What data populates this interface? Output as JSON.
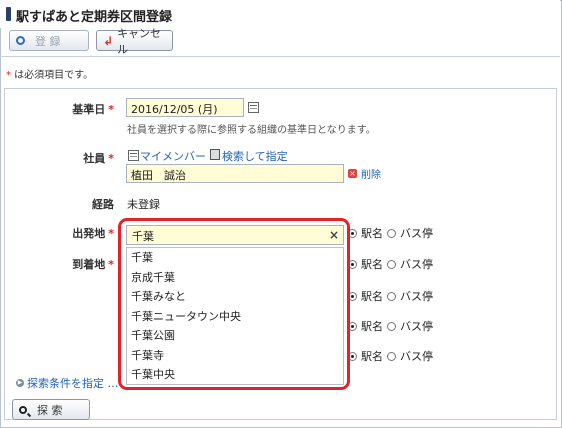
{
  "title": "駅すぱあと定期券区間登録",
  "toolbar": {
    "save_label": "登 録",
    "cancel_label": "キャンセル"
  },
  "required_note": {
    "star": "*",
    "text": " は必須項目です。"
  },
  "form": {
    "base_date": {
      "label": "基準日",
      "value": "2016/12/05 (月)",
      "note": "社員を選択する際に参照する組織の基準日となります。"
    },
    "employee": {
      "label": "社員",
      "my_member": "マイメンバー",
      "search_specify": "検索して指定",
      "value": "植田　誠治",
      "delete": "削除"
    },
    "route": {
      "label": "経路",
      "value": "未登録"
    },
    "departure": {
      "label": "出発地"
    },
    "arrival": {
      "label": "到着地"
    },
    "required_mark": "*"
  },
  "radio": {
    "station": "駅名",
    "bus": "バス停"
  },
  "dropdown": {
    "value": "千葉",
    "clear": "×",
    "items": [
      "千葉",
      "京成千葉",
      "千葉みなと",
      "千葉ニュータウン中央",
      "千葉公園",
      "千葉寺",
      "千葉中央"
    ]
  },
  "search_conditions_link": "探索条件を指定 …",
  "search_button": "探 索"
}
